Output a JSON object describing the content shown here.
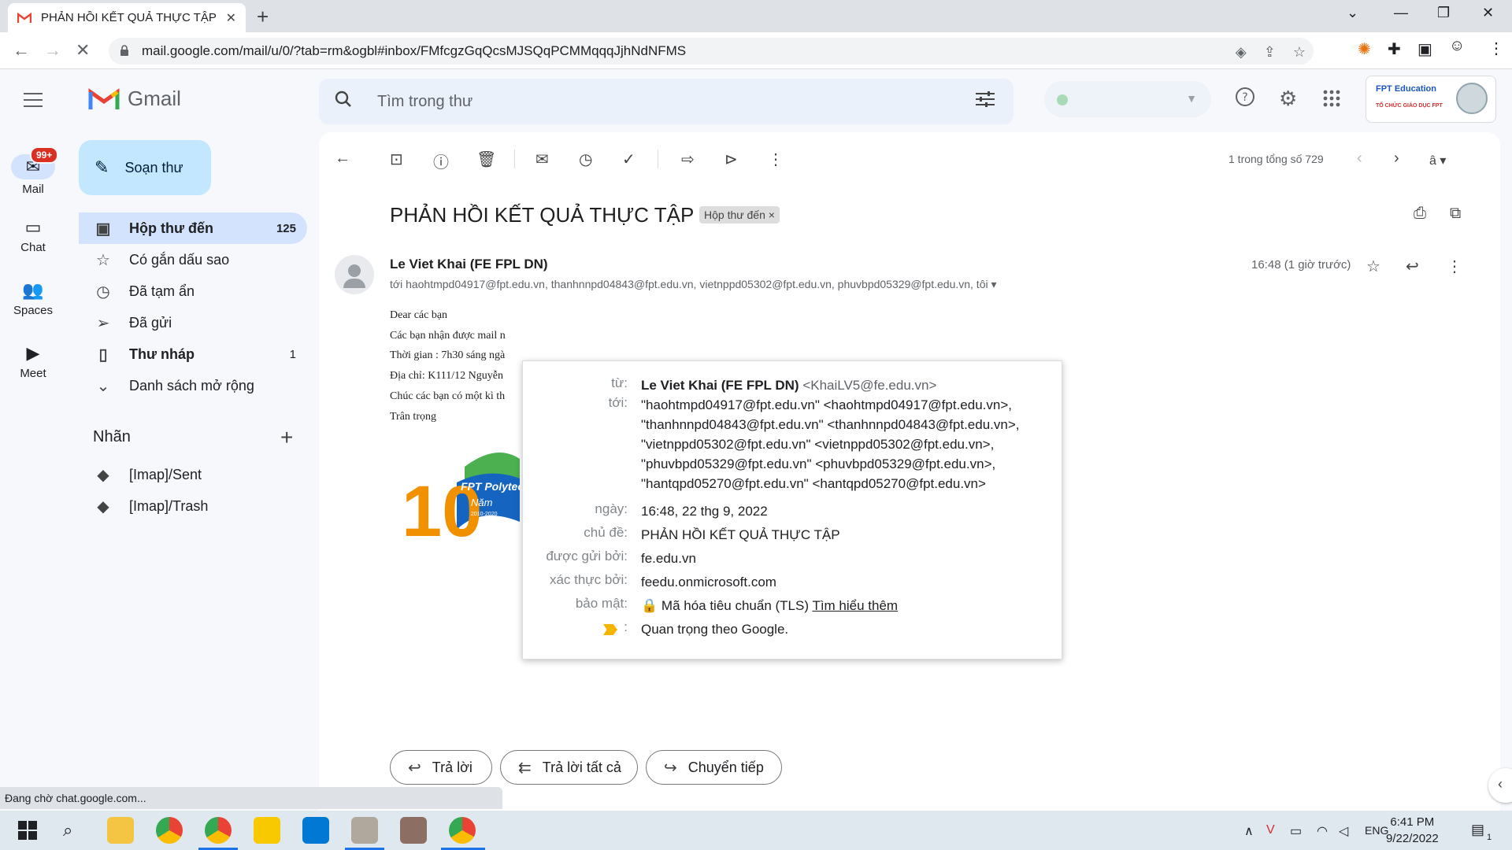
{
  "browser": {
    "tab_title": "PHẢN HỒI KẾT QUẢ THỰC TẬP -",
    "tab_close": "✕",
    "new_tab": "+",
    "url": "mail.google.com/mail/u/0/?tab=rm&ogbl#inbox/FMfcgzGqQcsMJSQqPCMMqqqJjhNdNFMS"
  },
  "gmail": {
    "logo_text": "Gmail",
    "search_placeholder": "Tìm trong thư",
    "account_org": "FPT Education",
    "account_sub": "TỔ CHỨC GIÁO DỤC FPT"
  },
  "rail": {
    "mail": "Mail",
    "mail_badge": "99+",
    "chat": "Chat",
    "spaces": "Spaces",
    "meet": "Meet"
  },
  "compose_label": "Soạn thư",
  "nav": [
    {
      "label": "Hộp thư đến",
      "count": "125"
    },
    {
      "label": "Có gắn dấu sao",
      "count": ""
    },
    {
      "label": "Đã tạm ẩn",
      "count": ""
    },
    {
      "label": "Đã gửi",
      "count": ""
    },
    {
      "label": "Thư nháp",
      "count": "1"
    },
    {
      "label": "Danh sách mở rộng",
      "count": ""
    }
  ],
  "labels": {
    "heading": "Nhãn",
    "items": [
      "[Imap]/Sent",
      "[Imap]/Trash"
    ]
  },
  "pager": "1 trong tổng số 729",
  "message": {
    "subject": "PHẢN HỒI KẾT QUẢ THỰC TẬP",
    "chip": "Hộp thư đến",
    "chip_close": "×",
    "sender": "Le Viet Khai (FE FPL DN)",
    "to_line": "tới haohtmpd04917@fpt.edu.vn, thanhnnpd04843@fpt.edu.vn, vietnppd05302@fpt.edu.vn, phuvbpd05329@fpt.edu.vn, tôi",
    "time": "16:48 (1 giờ trước)",
    "body": [
      "Dear các bạn",
      "Các bạn nhận được mail n",
      "Thời gian : 7h30 sáng ngà",
      "Địa chỉ: K111/12 Nguyễn",
      "Chúc các bạn có một kì th",
      "Trân trọng"
    ],
    "banner_text": "FPT Polytec",
    "banner_sub": "Năm",
    "banner_years": "2010-2020",
    "banner_number": "10"
  },
  "details": {
    "from_key": "từ:",
    "from_name": "Le Viet Khai (FE FPL DN)",
    "from_email": "<KhaiLV5@fe.edu.vn>",
    "to_key": "tới:",
    "to_lines": [
      "\"haohtmpd04917@fpt.edu.vn\" <haohtmpd04917@fpt.edu.vn>,",
      "\"thanhnnpd04843@fpt.edu.vn\" <thanhnnpd04843@fpt.edu.vn>,",
      "\"vietnppd05302@fpt.edu.vn\" <vietnppd05302@fpt.edu.vn>,",
      "\"phuvbpd05329@fpt.edu.vn\" <phuvbpd05329@fpt.edu.vn>,",
      "\"hantqpd05270@fpt.edu.vn\" <hantqpd05270@fpt.edu.vn>"
    ],
    "date_key": "ngày:",
    "date": "16:48, 22 thg 9, 2022",
    "subject_key": "chủ đề:",
    "subject": "PHẢN HỒI KẾT QUẢ THỰC TẬP",
    "mailedby_key": "được gửi bởi:",
    "mailedby": "fe.edu.vn",
    "signedby_key": "xác thực bởi:",
    "signedby": "feedu.onmicrosoft.com",
    "security_key": "bảo mật:",
    "security": "Mã hóa tiêu chuẩn (TLS)",
    "learn_more": "Tìm hiểu thêm",
    "importance_key": ":",
    "importance": "Quan trọng theo Google."
  },
  "reply_buttons": {
    "reply": "Trả lời",
    "reply_all": "Trả lời tất cả",
    "forward": "Chuyển tiếp"
  },
  "status_text": "Đang chờ chat.google.com...",
  "taskbar": {
    "lang": "ENG",
    "time": "6:41 PM",
    "date": "9/22/2022",
    "notif": "1"
  }
}
